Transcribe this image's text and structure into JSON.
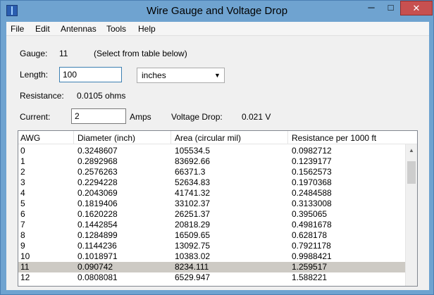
{
  "window": {
    "title": "Wire Gauge and Voltage Drop",
    "minimize": "─",
    "maximize": "□",
    "close": "✕"
  },
  "menu": [
    "File",
    "Edit",
    "Antennas",
    "Tools",
    "Help"
  ],
  "form": {
    "gauge_label": "Gauge:",
    "gauge_value": "11",
    "gauge_hint": "(Select from table below)",
    "length_label": "Length:",
    "length_value": "100",
    "unit_value": "inches",
    "resistance_label": "Resistance:",
    "resistance_value": "0.0105 ohms",
    "current_label": "Current:",
    "current_value": "2",
    "current_unit": "Amps",
    "vdrop_label": "Voltage Drop:",
    "vdrop_value": "0.021 V"
  },
  "table": {
    "headers": [
      "AWG",
      "Diameter (inch)",
      "Area (circular mil)",
      "Resistance per 1000 ft"
    ],
    "rows": [
      [
        "0",
        "0.3248607",
        "105534.5",
        "0.0982712"
      ],
      [
        "1",
        "0.2892968",
        "83692.66",
        "0.1239177"
      ],
      [
        "2",
        "0.2576263",
        "66371.3",
        "0.1562573"
      ],
      [
        "3",
        "0.2294228",
        "52634.83",
        "0.1970368"
      ],
      [
        "4",
        "0.2043069",
        "41741.32",
        "0.2484588"
      ],
      [
        "5",
        "0.1819406",
        "33102.37",
        "0.3133008"
      ],
      [
        "6",
        "0.1620228",
        "26251.37",
        "0.395065"
      ],
      [
        "7",
        "0.1442854",
        "20818.29",
        "0.4981678"
      ],
      [
        "8",
        "0.1284899",
        "16509.65",
        "0.628178"
      ],
      [
        "9",
        "0.1144236",
        "13092.75",
        "0.7921178"
      ],
      [
        "10",
        "0.1018971",
        "10383.02",
        "0.9988421"
      ],
      [
        "11",
        "0.090742",
        "8234.111",
        "1.259517"
      ],
      [
        "12",
        "0.0808081",
        "6529.947",
        "1.588221"
      ]
    ],
    "selected_index": 11
  }
}
